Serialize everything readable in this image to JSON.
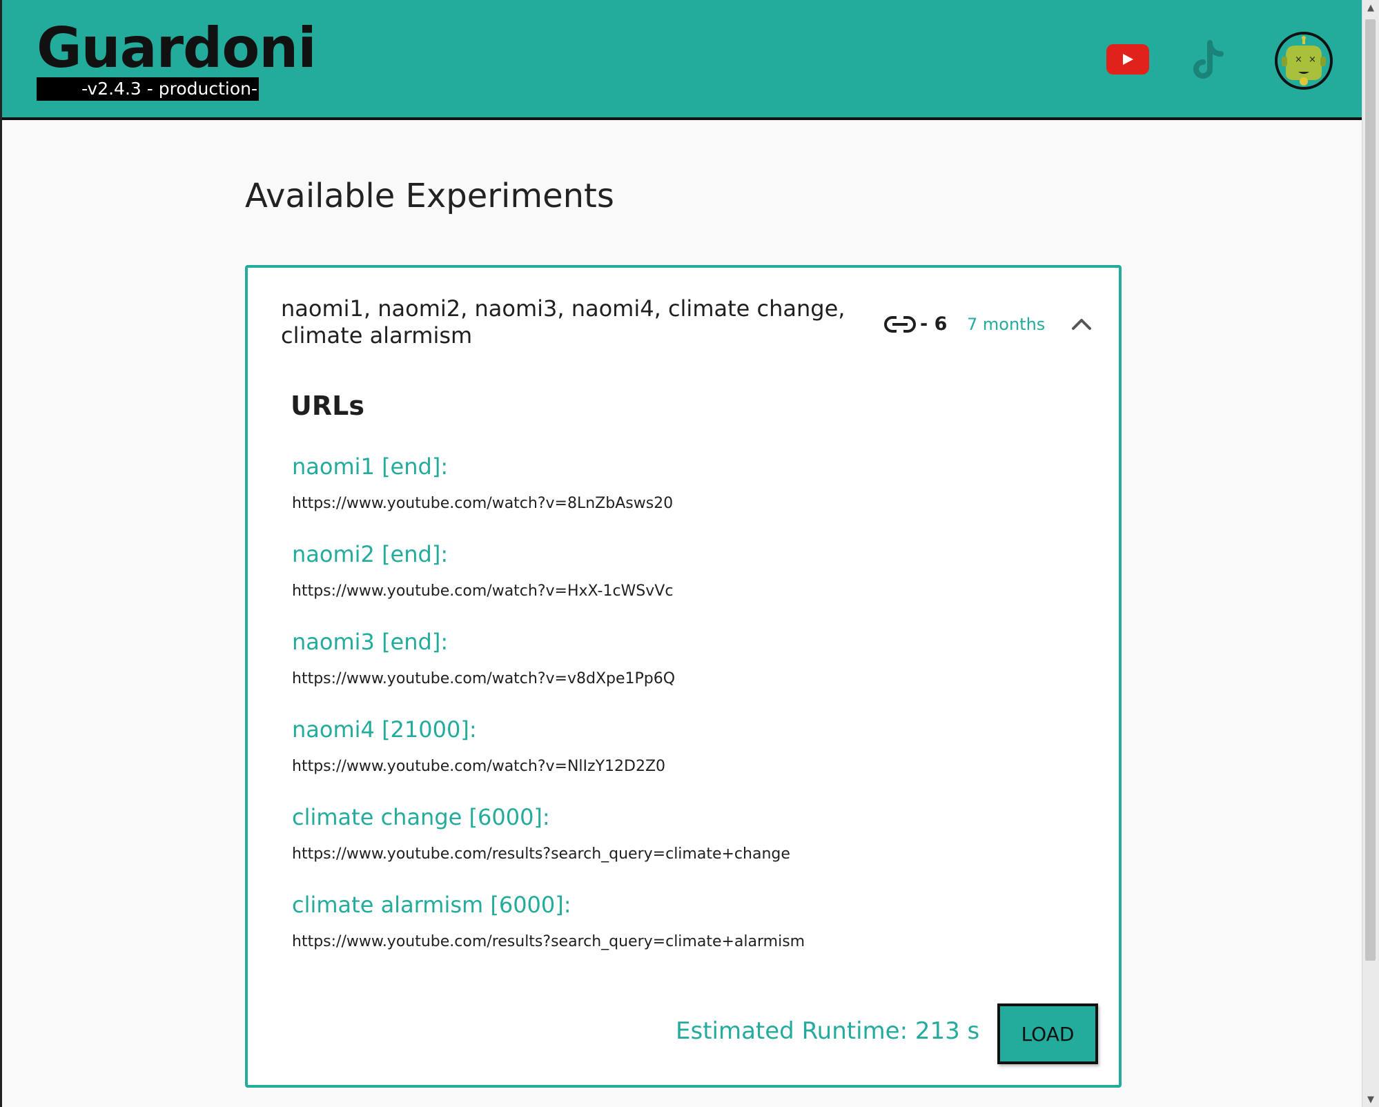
{
  "colors": {
    "brand": "#23ab9c",
    "header_border": "#111111",
    "text": "#1f1f1f",
    "youtube_red": "#e1221c",
    "avatar_face": "#a9c13a"
  },
  "header": {
    "title": "Guardoni",
    "version": "-v2.4.3 - production-",
    "icons": [
      "youtube-icon",
      "tiktok-icon",
      "avatar"
    ]
  },
  "main": {
    "title": "Available Experiments"
  },
  "experiment": {
    "title": "naomi1, naomi2, naomi3, naomi4, climate change, climate alarmism",
    "link_count": "- 6",
    "age": "7 months",
    "expanded": true,
    "urls_heading": "URLs",
    "urls": [
      {
        "label": "naomi1 [end]:",
        "url": "https://www.youtube.com/watch?v=8LnZbAsws20"
      },
      {
        "label": "naomi2 [end]:",
        "url": "https://www.youtube.com/watch?v=HxX-1cWSvVc"
      },
      {
        "label": "naomi3 [end]:",
        "url": "https://www.youtube.com/watch?v=v8dXpe1Pp6Q"
      },
      {
        "label": "naomi4 [21000]:",
        "url": "https://www.youtube.com/watch?v=NlIzY12D2Z0"
      },
      {
        "label": "climate change [6000]:",
        "url": "https://www.youtube.com/results?search_query=climate+change"
      },
      {
        "label": "climate alarmism [6000]:",
        "url": "https://www.youtube.com/results?search_query=climate+alarmism"
      }
    ],
    "runtime": "Estimated Runtime: 213 s",
    "load_label": "LOAD"
  }
}
